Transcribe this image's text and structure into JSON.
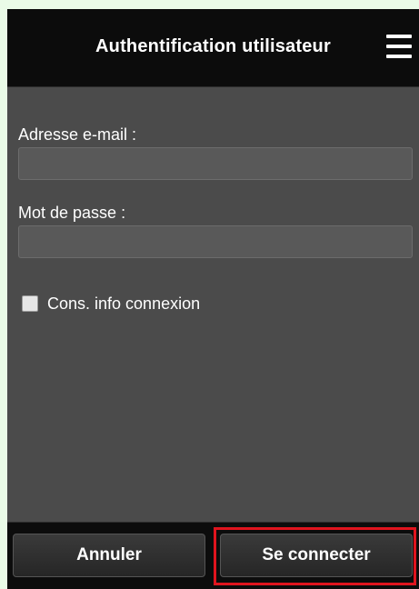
{
  "header": {
    "title": "Authentification utilisateur",
    "menu_icon": "hamburger-menu-icon"
  },
  "form": {
    "email_label": "Adresse e-mail :",
    "email_value": "",
    "password_label": "Mot de passe :",
    "password_value": "",
    "remember_label": "Cons. info connexion",
    "remember_checked": false
  },
  "footer": {
    "cancel_label": "Annuler",
    "login_label": "Se connecter"
  },
  "colors": {
    "page_background": "#eafbe7",
    "header_background": "#0c0c0c",
    "body_background": "#4b4b4b",
    "highlight": "#e0141e"
  }
}
